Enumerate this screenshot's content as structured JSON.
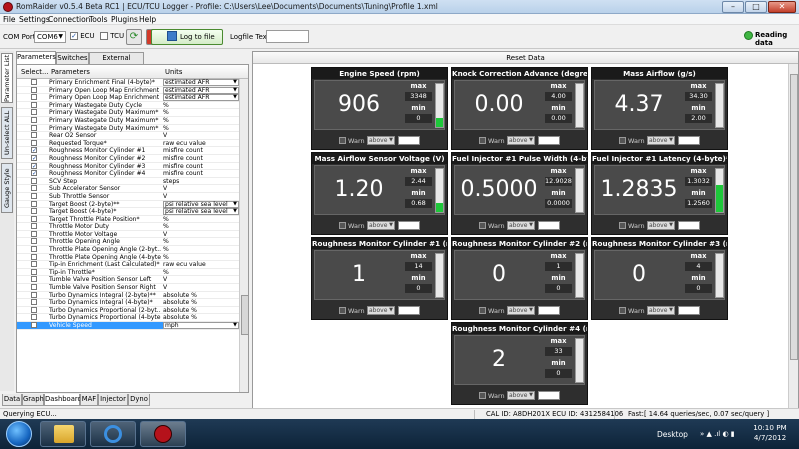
{
  "window": {
    "title": "RomRaider v0.5.4 Beta RC1 | ECU/TCU Logger - Profile: C:\\Users\\Lee\\Documents\\Documents\\Tuning\\Profile 1.xml",
    "minimize": "–",
    "maximize": "□",
    "close": "✕"
  },
  "menu": [
    "File",
    "Settings",
    "Connection",
    "Tools",
    "Plugins",
    "Help"
  ],
  "toolbar": {
    "com_port_label": "COM Port:",
    "com_port_value": "COM6",
    "ecu_label": "ECU",
    "ecu_checked": true,
    "tcu_label": "TCU",
    "tcu_checked": false,
    "log_to_file_label": "Log to file",
    "logfile_text_label": "Logfile Text",
    "logfile_text_value": "",
    "status_text": "Reading data",
    "status_color": "#3fb542"
  },
  "side_tabs": [
    "Parameter List",
    "Un-select ALL",
    "Gauge Style"
  ],
  "param_tabs": [
    "Parameters",
    "Switches",
    "External Sensors"
  ],
  "table": {
    "headers": [
      "Select...",
      "Parameters",
      "Units"
    ],
    "rows": [
      {
        "checked": false,
        "name": "Primary Enrichment Final (4-byte)*",
        "unit": "estimated AFR",
        "dropdown": true
      },
      {
        "checked": false,
        "name": "Primary Open Loop Map Enrichment ...",
        "unit": "estimated AFR",
        "dropdown": true
      },
      {
        "checked": false,
        "name": "Primary Open Loop Map Enrichment ...",
        "unit": "estimated AFR",
        "dropdown": true
      },
      {
        "checked": false,
        "name": "Primary Wastegate Duty Cycle",
        "unit": "%",
        "dropdown": false
      },
      {
        "checked": false,
        "name": "Primary Wastegate Duty Maximum* ...",
        "unit": "%",
        "dropdown": false
      },
      {
        "checked": false,
        "name": "Primary Wastegate Duty Maximum* ...",
        "unit": "%",
        "dropdown": false
      },
      {
        "checked": false,
        "name": "Primary Wastegate Duty Maximum* ...",
        "unit": "%",
        "dropdown": false
      },
      {
        "checked": false,
        "name": "Rear O2 Sensor",
        "unit": "V",
        "dropdown": false
      },
      {
        "checked": false,
        "name": "Requested Torque*",
        "unit": "raw ecu value",
        "dropdown": false
      },
      {
        "checked": true,
        "name": "Roughness Monitor Cylinder #1",
        "unit": "misfire count",
        "dropdown": false
      },
      {
        "checked": true,
        "name": "Roughness Monitor Cylinder #2",
        "unit": "misfire count",
        "dropdown": false
      },
      {
        "checked": true,
        "name": "Roughness Monitor Cylinder #3",
        "unit": "misfire count",
        "dropdown": false
      },
      {
        "checked": true,
        "name": "Roughness Monitor Cylinder #4",
        "unit": "misfire count",
        "dropdown": false
      },
      {
        "checked": false,
        "name": "SCV Step",
        "unit": "steps",
        "dropdown": false
      },
      {
        "checked": false,
        "name": "Sub Accelerator Sensor",
        "unit": "V",
        "dropdown": false
      },
      {
        "checked": false,
        "name": "Sub Throttle Sensor",
        "unit": "V",
        "dropdown": false
      },
      {
        "checked": false,
        "name": "Target Boost (2-byte)**",
        "unit": "psi relative sea level",
        "dropdown": true
      },
      {
        "checked": false,
        "name": "Target Boost (4-byte)*",
        "unit": "psi relative sea level",
        "dropdown": true
      },
      {
        "checked": false,
        "name": "Target Throttle Plate Position*",
        "unit": "%",
        "dropdown": false
      },
      {
        "checked": false,
        "name": "Throttle Motor Duty",
        "unit": "%",
        "dropdown": false
      },
      {
        "checked": false,
        "name": "Throttle Motor Voltage",
        "unit": "V",
        "dropdown": false
      },
      {
        "checked": false,
        "name": "Throttle Opening Angle",
        "unit": "%",
        "dropdown": false
      },
      {
        "checked": false,
        "name": "Throttle Plate Opening Angle (2-byt...",
        "unit": "%",
        "dropdown": false
      },
      {
        "checked": false,
        "name": "Throttle Plate Opening Angle (4-byte)*",
        "unit": "%",
        "dropdown": false
      },
      {
        "checked": false,
        "name": "Tip-in Enrichment (Last Calculated)*",
        "unit": "raw ecu value",
        "dropdown": false
      },
      {
        "checked": false,
        "name": "Tip-in Throttle*",
        "unit": "%",
        "dropdown": false
      },
      {
        "checked": false,
        "name": "Tumble Valve Position Sensor Left",
        "unit": "V",
        "dropdown": false
      },
      {
        "checked": false,
        "name": "Tumble Valve Position Sensor Right",
        "unit": "V",
        "dropdown": false
      },
      {
        "checked": false,
        "name": "Turbo Dynamics Integral (2-byte)**",
        "unit": "absolute %",
        "dropdown": false
      },
      {
        "checked": false,
        "name": "Turbo Dynamics Integral (4-byte)*",
        "unit": "absolute %",
        "dropdown": false
      },
      {
        "checked": false,
        "name": "Turbo Dynamics Proportional (2-byt...",
        "unit": "absolute %",
        "dropdown": false
      },
      {
        "checked": false,
        "name": "Turbo Dynamics Proportional (4-byte)*",
        "unit": "absolute %",
        "dropdown": false
      },
      {
        "checked": false,
        "name": "Vehicle Speed",
        "unit": "mph",
        "dropdown": true,
        "selected": true
      }
    ]
  },
  "bottom_tabs": [
    "Data",
    "Graph",
    "Dashboard",
    "MAF",
    "Injector",
    "Dyno"
  ],
  "reset_data_label": "Reset Data",
  "gauges": [
    {
      "title": "Engine Speed (rpm)",
      "value": "906",
      "max": "3348",
      "min": "0",
      "level": 0.2
    },
    {
      "title": "Knock Correction Advance (degrees)",
      "value": "0.00",
      "max": "4.00",
      "min": "0.00",
      "level": 0
    },
    {
      "title": "Mass Airflow (g/s)",
      "value": "4.37",
      "max": "34.30",
      "min": "2.00",
      "level": 0
    },
    {
      "title": "Mass Airflow Sensor Voltage (V)",
      "value": "1.20",
      "max": "2.44",
      "min": "0.68",
      "level": 0.2
    },
    {
      "title": "Fuel Injector #1 Pulse Width (4-byt...",
      "value": "0.5000",
      "max": "12.9028",
      "min": "0.0000",
      "level": 0
    },
    {
      "title": "Fuel Injector #1 Latency (4-byte)* (...",
      "value": "1.2835",
      "max": "1.3032",
      "min": "1.2560",
      "level": 0.62
    },
    {
      "title": "Roughness Monitor Cylinder #1 (mis...",
      "value": "1",
      "max": "14",
      "min": "0",
      "level": 0
    },
    {
      "title": "Roughness Monitor Cylinder #2 (mis...",
      "value": "0",
      "max": "1",
      "min": "0",
      "level": 0
    },
    {
      "title": "Roughness Monitor Cylinder #3 (mis...",
      "value": "0",
      "max": "4",
      "min": "0",
      "level": 0
    },
    {
      "title": "Roughness Monitor Cylinder #4 (mis...",
      "value": "2",
      "max": "33",
      "min": "0",
      "level": 0
    }
  ],
  "gauge_labels": {
    "max": "max",
    "min": "min",
    "warn": "Warn",
    "condition": "above"
  },
  "statusbar": {
    "left": "Querying ECU...",
    "middle": "CAL ID: A8DH201X  ECU ID: 4312584106",
    "right": "Fast:[ 14.64 queries/sec, 0.07 sec/query ]"
  },
  "taskbar": {
    "desktop_label": "Desktop",
    "tray_text": "»  ▲ .ıl ◐ ▮",
    "time": "10:10 PM",
    "date": "4/7/2012"
  }
}
